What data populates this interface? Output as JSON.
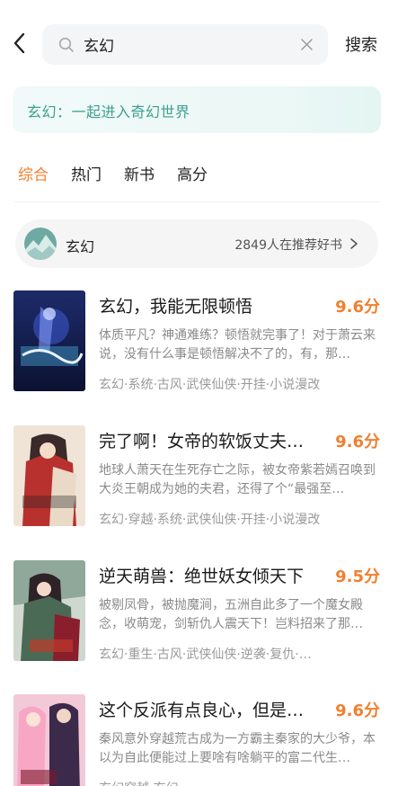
{
  "search": {
    "query": "玄幻",
    "action_label": "搜索"
  },
  "banner": {
    "text": "玄幻：一起进入奇幻世界"
  },
  "tabs": [
    {
      "label": "综合",
      "active": true
    },
    {
      "label": "热门",
      "active": false
    },
    {
      "label": "新书",
      "active": false
    },
    {
      "label": "高分",
      "active": false
    }
  ],
  "topic": {
    "name": "玄幻",
    "count_text": "2849人在推荐好书"
  },
  "books": [
    {
      "title": "玄幻，我能无限顿悟",
      "score": "9.6分",
      "description": "体质平凡？神通难练？顿悟就完事了！对于萧云来说，没有什么事是顿悟解决不了的，有，那…",
      "tags": "玄幻·系统·古风·武侠仙侠·开挂·小说漫改"
    },
    {
      "title": "完了啊！女帝的软饭丈夫…",
      "score": "9.6分",
      "description": "地球人萧天在生死存亡之际，被女帝紫若嫣召唤到大炎王朝成为她的夫君，还得了个“最强至…",
      "tags": "玄幻·穿越·系统·武侠仙侠·开挂·小说漫改"
    },
    {
      "title": "逆天萌兽：绝世妖女倾天下",
      "score": "9.5分",
      "description": "被剔凤骨，被抛魔涧，五洲自此多了一个魔女殿念，收萌宠，剑斩仇人震天下！岂料招来了那…",
      "tags": "玄幻·重生·古风·武侠仙侠·逆袭·复仇·…"
    },
    {
      "title": "这个反派有点良心，但是…",
      "score": "9.6分",
      "description": "秦风意外穿越荒古成为一方霸主秦家的大少爷，本以为自此便能过上要啥有啥躺平的富二代生…",
      "tags": "玄幻穿越·玄幻"
    }
  ],
  "colors": {
    "accent": "#f0802f",
    "banner_text": "#3d9e90"
  }
}
